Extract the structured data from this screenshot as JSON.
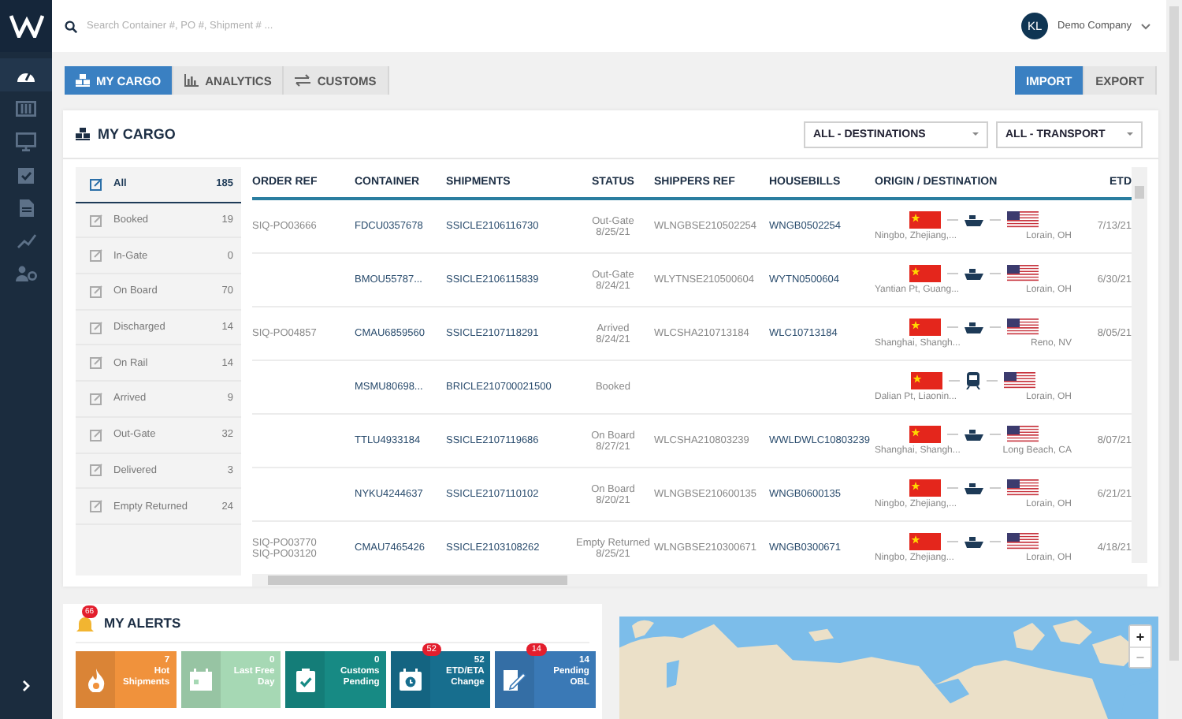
{
  "sidebar": {
    "items": [
      {
        "kind": "gauge",
        "selected": true
      },
      {
        "kind": "container",
        "selected": false
      },
      {
        "kind": "monitor",
        "selected": false
      },
      {
        "kind": "clipboard",
        "selected": false
      },
      {
        "kind": "document",
        "selected": false
      },
      {
        "kind": "chart",
        "selected": false
      },
      {
        "kind": "users",
        "selected": false
      }
    ]
  },
  "search": {
    "placeholder": "Search Container #, PO #, Shipment # ..."
  },
  "user": {
    "initials": "KL",
    "company": "Demo Company"
  },
  "tabs": [
    {
      "label": "MY CARGO",
      "kind": "pallet",
      "selected": true
    },
    {
      "label": "ANALYTICS",
      "kind": "chart",
      "selected": false
    },
    {
      "label": "CUSTOMS",
      "kind": "arrows",
      "selected": false
    }
  ],
  "direction_toggle": [
    {
      "label": "IMPORT",
      "selected": true
    },
    {
      "label": "EXPORT",
      "selected": false
    }
  ],
  "cargo": {
    "title": "MY CARGO",
    "dropdowns": [
      {
        "value": "ALL - DESTINATIONS"
      },
      {
        "value": "ALL - TRANSPORT"
      }
    ],
    "filters": [
      {
        "label": "All",
        "count": "185",
        "selected": true
      },
      {
        "label": "Booked",
        "count": "19",
        "selected": false
      },
      {
        "label": "In-Gate",
        "count": "0",
        "selected": false
      },
      {
        "label": "On Board",
        "count": "70",
        "selected": false
      },
      {
        "label": "Discharged",
        "count": "14",
        "selected": false
      },
      {
        "label": "On Rail",
        "count": "14",
        "selected": false
      },
      {
        "label": "Arrived",
        "count": "9",
        "selected": false
      },
      {
        "label": "Out-Gate",
        "count": "32",
        "selected": false
      },
      {
        "label": "Delivered",
        "count": "3",
        "selected": false
      },
      {
        "label": "Empty Returned",
        "count": "24",
        "selected": false
      }
    ],
    "table": {
      "columns": [
        "ORDER REF",
        "CONTAINER",
        "SHIPMENTS",
        "STATUS",
        "SHIPPERS REF",
        "HOUSEBILLS",
        "ORIGIN / DESTINATION",
        "ETD"
      ],
      "rows": [
        {
          "order_refs": [
            "SIQ-PO03666"
          ],
          "container": "FDCU0357678",
          "shipment": "SSICLE2106116730",
          "status": "Out-Gate",
          "status_date": "8/25/21",
          "shippers_ref": "WLNGBSE210502254",
          "housebill": "WNGB0502254",
          "kind": "ship",
          "origin": "Ningbo, Zhejiang,...",
          "destination": "Lorain, OH",
          "etd": "7/13/21"
        },
        {
          "order_refs": [],
          "container": "BMOU55787...",
          "shipment": "SSICLE2106115839",
          "status": "Out-Gate",
          "status_date": "8/24/21",
          "shippers_ref": "WLYTNSE210500604",
          "housebill": "WYTN0500604",
          "kind": "ship",
          "origin": "Yantian Pt, Guang...",
          "destination": "Lorain, OH",
          "etd": "6/30/21"
        },
        {
          "order_refs": [
            "SIQ-PO04857"
          ],
          "container": "CMAU6859560",
          "shipment": "SSICLE2107118291",
          "status": "Arrived",
          "status_date": "8/24/21",
          "shippers_ref": "WLCSHA210713184",
          "housebill": "WLC10713184",
          "kind": "ship",
          "origin": "Shanghai, Shangh...",
          "destination": "Reno, NV",
          "etd": "8/05/21"
        },
        {
          "order_refs": [],
          "container": "MSMU80698...",
          "shipment": "BRICLE210700021500",
          "status": "Booked",
          "kind": "train",
          "origin": "Dalian Pt, Liaonin...",
          "destination": "Lorain, OH"
        },
        {
          "order_refs": [],
          "container": "TTLU4933184",
          "shipment": "SSICLE2107119686",
          "status": "On Board",
          "status_date": "8/27/21",
          "shippers_ref": "WLCSHA210803239",
          "housebill": "WWLDWLC10803239",
          "kind": "ship",
          "origin": "Shanghai, Shangh...",
          "destination": "Long Beach, CA",
          "etd": "8/07/21"
        },
        {
          "order_refs": [],
          "container": "NYKU4244637",
          "shipment": "SSICLE2107110102",
          "status": "On Board",
          "status_date": "8/20/21",
          "shippers_ref": "WLNGBSE210600135",
          "housebill": "WNGB0600135",
          "kind": "ship",
          "origin": "Ningbo, Zhejiang,...",
          "destination": "Lorain, OH",
          "etd": "6/21/21"
        },
        {
          "order_refs": [
            "SIQ-PO03770",
            "SIQ-PO03120"
          ],
          "container": "CMAU7465426",
          "shipment": "SSICLE2103108262",
          "status": "Empty Returned",
          "status_date": "8/25/21",
          "shippers_ref": "WLNGBSE210300671",
          "housebill": "WNGB0300671",
          "kind": "ship",
          "origin": "Ningbo, Zhejiang...",
          "destination": "Lorain, OH",
          "etd": "4/18/21"
        }
      ]
    }
  },
  "alerts": {
    "title": "MY ALERTS",
    "badge": "66",
    "tiles": [
      {
        "kind": "fire",
        "count": "7",
        "label": "Hot Shipments",
        "color": "#f0923c"
      },
      {
        "kind": "calendar",
        "count": "0",
        "label": "Last Free Day",
        "color": "#a6d8b4"
      },
      {
        "kind": "clipboard",
        "count": "0",
        "label": "Customs Pending",
        "color": "#178a84"
      },
      {
        "kind": "clock",
        "count": "52",
        "label": "ETD/ETA Change",
        "color": "#176e8e",
        "badge": "52"
      },
      {
        "kind": "pen",
        "count": "14",
        "label": "Pending OBL",
        "color": "#3a79b6",
        "badge": "14"
      }
    ]
  },
  "map": {
    "kind": "picture",
    "controls": [
      {
        "label": "+",
        "disabled": false
      },
      {
        "label": "−",
        "disabled": true
      }
    ]
  }
}
